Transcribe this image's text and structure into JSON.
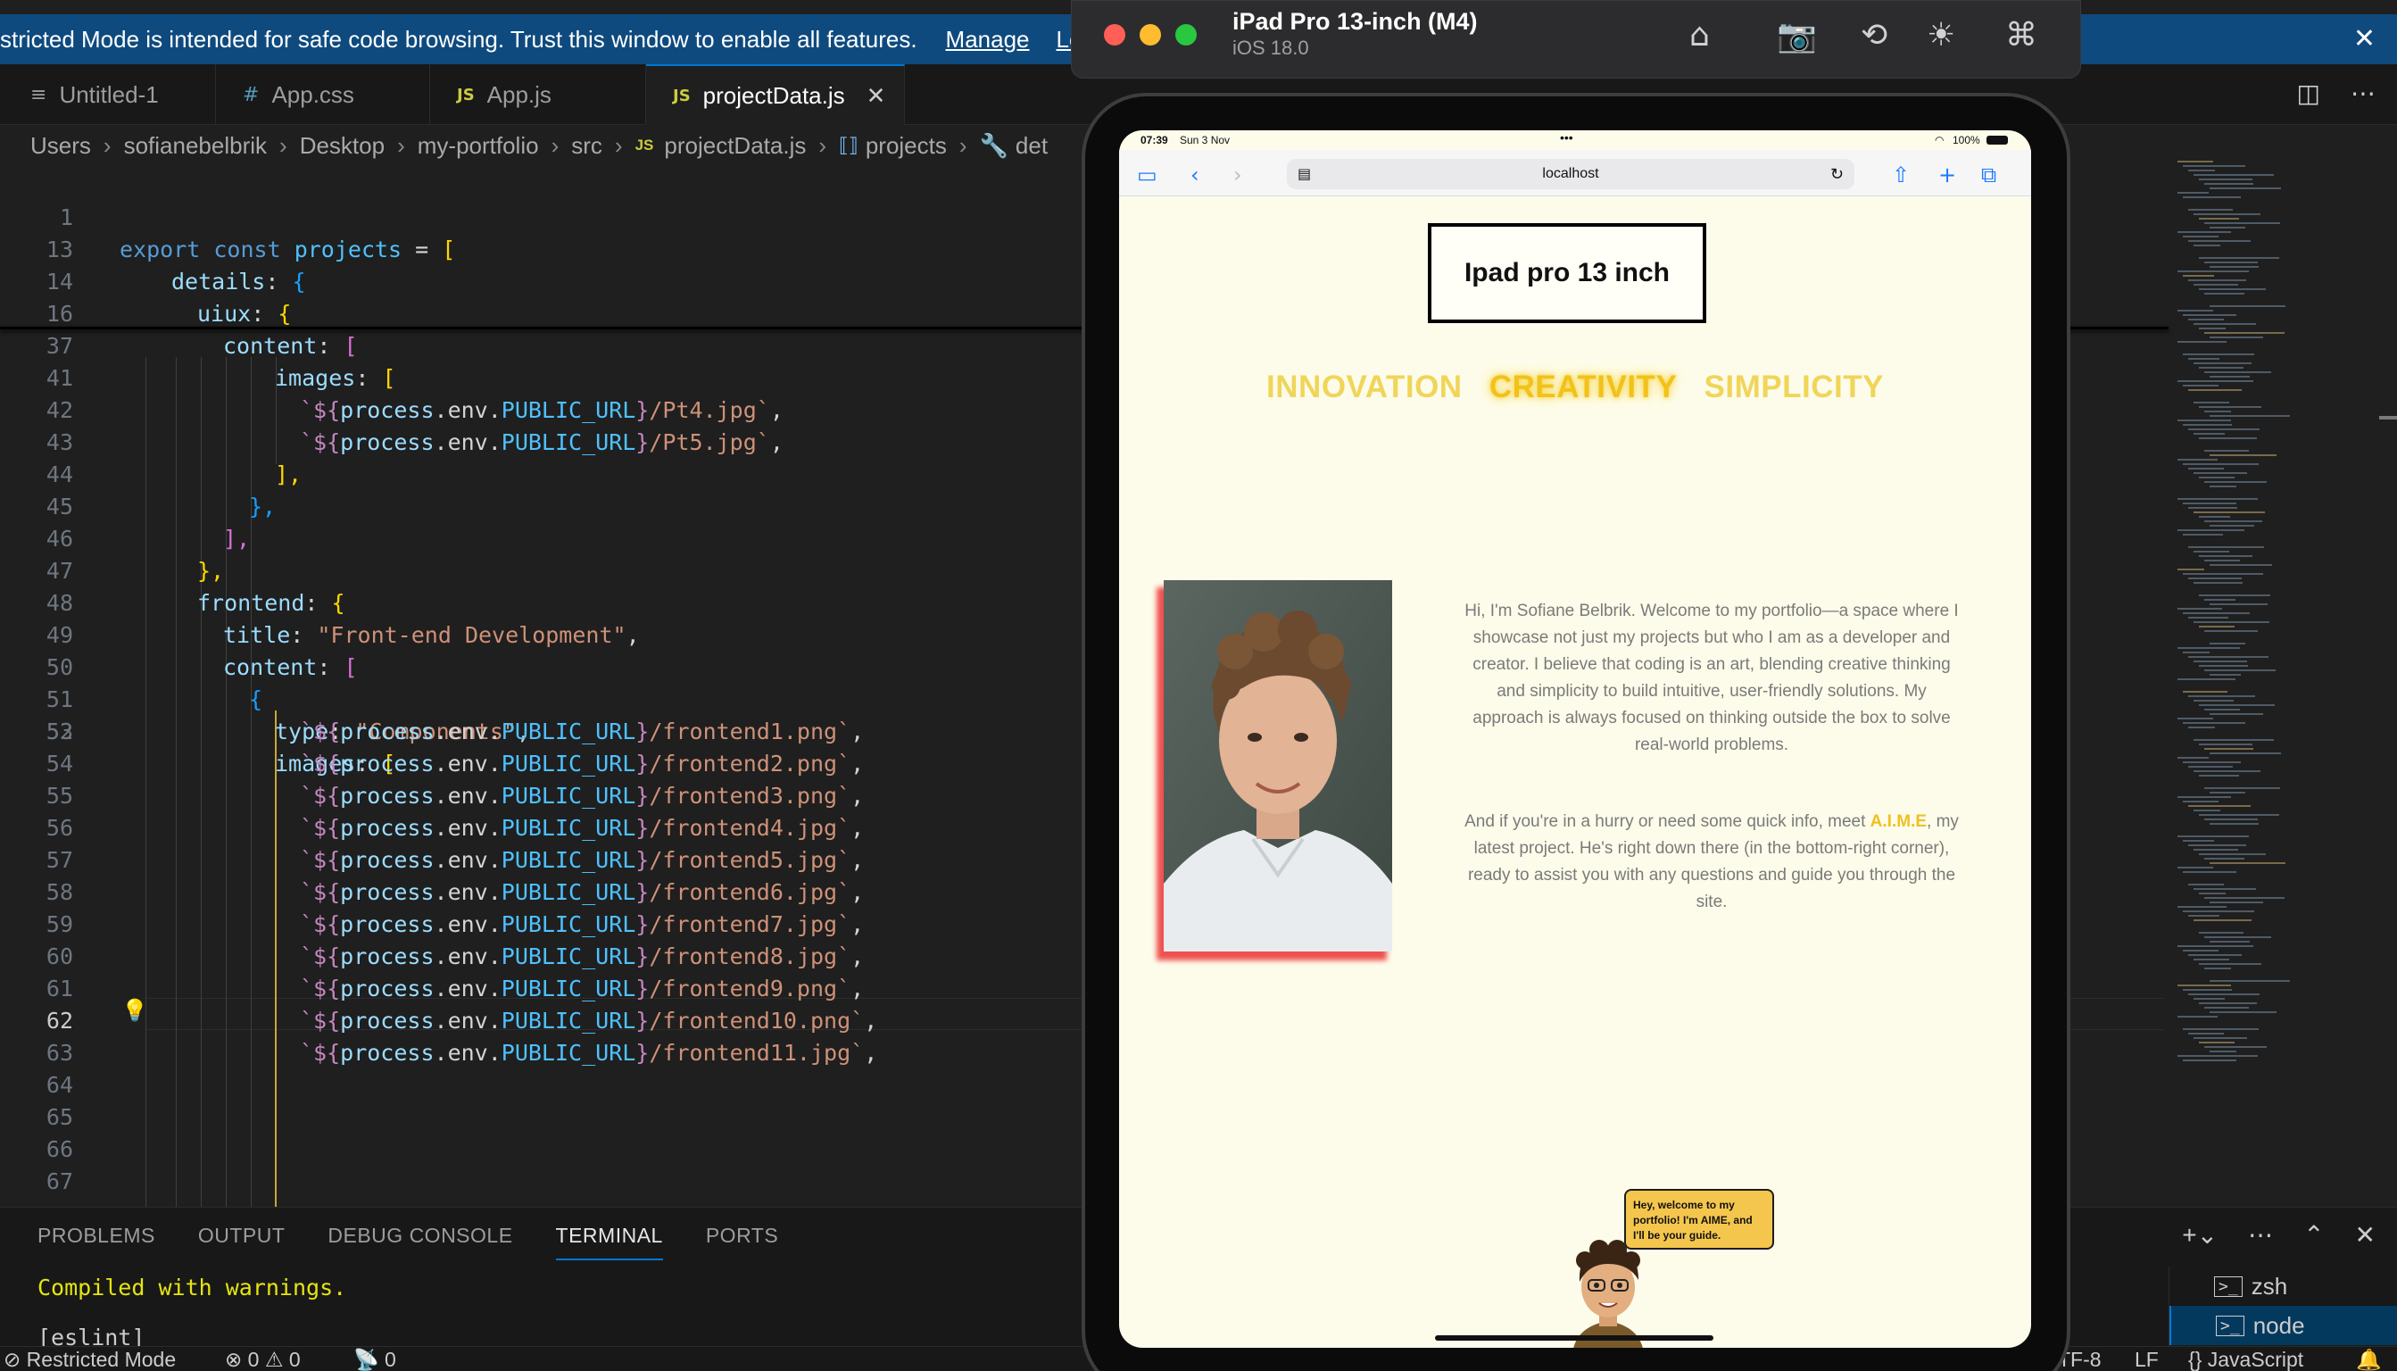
{
  "vscode": {
    "banner": {
      "message": "stricted Mode is intended for safe code browsing. Trust this window to enable all features.",
      "manage": "Manage",
      "learn": "Le"
    },
    "tabs": [
      {
        "icon": "≡",
        "label": "Untitled-1"
      },
      {
        "icon": "#",
        "label": "App.css"
      },
      {
        "icon": "JS",
        "label": "App.js"
      },
      {
        "icon": "JS",
        "label": "projectData.js"
      }
    ],
    "breadcrumb": [
      "Users",
      "sofianebelbrik",
      "Desktop",
      "my-portfolio",
      "src",
      "projectData.js",
      "projects",
      "det"
    ],
    "breadcrumb_js_icon": "JS",
    "line_numbers": {
      "sticky": [
        "1",
        "13",
        "14",
        "16",
        "37"
      ],
      "main": [
        "41",
        "42",
        "43",
        "44",
        "45",
        "46",
        "47",
        "48",
        "49",
        "50",
        "51",
        "52",
        "53",
        "54",
        "55",
        "56",
        "57",
        "58",
        "59",
        "60",
        "61",
        "62",
        "63",
        "64",
        "65",
        "66",
        "67"
      ]
    },
    "code": {
      "l1_a": "export",
      "l1_b": "const",
      "l1_c": "projects",
      "l1_d": " = ",
      "l1_e": "[",
      "l13_a": "details",
      "l13_b": ": ",
      "l13_c": "{",
      "l14_a": "uiux",
      "l14_b": ": ",
      "l14_c": "{",
      "l16_a": "content",
      "l16_b": ": ",
      "l16_c": "[",
      "l37_a": "images",
      "l37_b": ": ",
      "l37_c": "[",
      "tpl_open": "`${",
      "tpl_proc": "process",
      "tpl_env": ".env.",
      "tpl_url": "PUBLIC_URL",
      "tpl_close": "}",
      "f41": "/Pt4.jpg`",
      "f42": "/Pt5.jpg`",
      "l43": "],",
      "l44": "},",
      "l45": "],",
      "l46": "},",
      "l47_a": "frontend",
      "l47_b": ": ",
      "l47_c": "{",
      "l48_a": "title",
      "l48_b": ": ",
      "l48_c": "\"Front-end Development\"",
      "l48_d": ",",
      "l49_a": "content",
      "l49_b": ": ",
      "l49_c": "[",
      "l50": "{",
      "l51_a": "type",
      "l51_b": ": ",
      "l51_c": "\"Components\"",
      "l51_d": ",",
      "l52_a": "images",
      "l52_b": ": ",
      "l52_c": "[",
      "f53": "/frontend1.png`",
      "f54": "/frontend2.png`",
      "f55": "/frontend3.png`",
      "f56": "/frontend4.jpg`",
      "f57": "/frontend5.jpg`",
      "f58": "/frontend6.jpg`",
      "f59": "/frontend7.jpg`",
      "f60": "/frontend8.jpg`",
      "f61": "/frontend9.png`",
      "f62": "/frontend10.png`",
      "f63": "/frontend11.jpg`",
      "comma": ","
    },
    "panel": {
      "tabs": [
        "PROBLEMS",
        "OUTPUT",
        "DEBUG CONSOLE",
        "TERMINAL",
        "PORTS"
      ],
      "active_tab": "TERMINAL",
      "output_line1": "Compiled with warnings.",
      "output_line2": "[eslint]",
      "terminals": [
        "zsh",
        "node"
      ]
    },
    "status": {
      "restricted": "Restricted Mode",
      "errors": "0",
      "warnings": "0",
      "ports": "0",
      "encoding": "TF-8",
      "eol": "LF",
      "language": "JavaScript"
    }
  },
  "simulator": {
    "device": "iPad Pro 13-inch (M4)",
    "os": "iOS 18.0",
    "status_time": "07:39",
    "status_date": "Sun 3 Nov",
    "status_battery": "100%",
    "url": "localhost",
    "site": {
      "title": "Ipad pro 13 inch",
      "tagline": [
        "INNOVATION",
        "CREATIVITY",
        "SIMPLICITY"
      ],
      "bio1": "Hi, I'm Sofiane Belbrik. Welcome to my portfolio—a space where I showcase not just my projects but who I am as a developer and creator. I believe that coding is an art, blending creative thinking and simplicity to build intuitive, user-friendly solutions. My approach is always focused on thinking outside the box to solve real-world problems.",
      "bio2_pre": "And if you're in a hurry or need some quick info, meet ",
      "bio2_link": "A.I.M.E",
      "bio2_post": ", my latest project. He's right down there (in the bottom-right corner), ready to assist you with any questions and guide you through the site.",
      "bubble": "Hey, welcome to my portfolio! I'm AIME, and I'll be your guide."
    }
  },
  "colors": {
    "banner": "#0e4a7e",
    "accent": "#0078d4",
    "tagline_yellow": "#f0d55a",
    "photo_shadow": "#ef5050",
    "bubble": "#f5c64d"
  }
}
